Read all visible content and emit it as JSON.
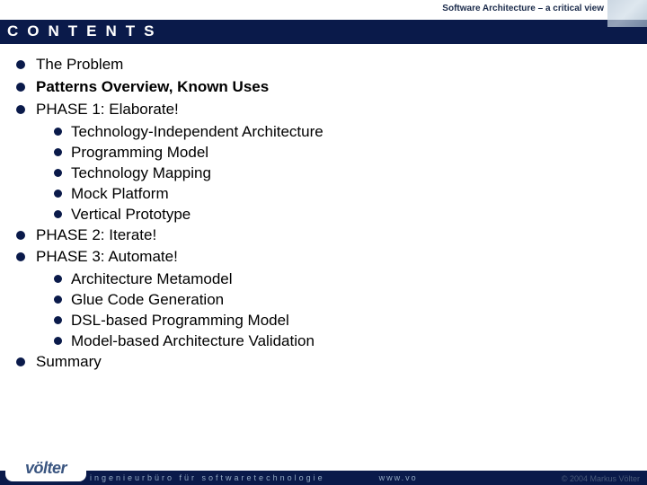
{
  "header_title": "Software Architecture – a critical view",
  "slide_title": "CONTENTS",
  "items": [
    {
      "text": "The Problem",
      "bold": false
    },
    {
      "text": "Patterns Overview, Known Uses",
      "bold": true
    },
    {
      "text": "PHASE 1: Elaborate!",
      "bold": false
    },
    {
      "sub": [
        "Technology-Independent Architecture",
        "Programming Model",
        "Technology Mapping",
        "Mock Platform",
        "Vertical Prototype"
      ]
    },
    {
      "text": "PHASE 2: Iterate!",
      "bold": false
    },
    {
      "text": "PHASE 3: Automate!",
      "bold": false
    },
    {
      "sub": [
        "Architecture Metamodel",
        "Glue Code Generation",
        "DSL-based Programming Model",
        "Model-based Architecture Validation"
      ]
    },
    {
      "text": "Summary",
      "bold": false
    }
  ],
  "footer_tagline": "ingenieurbüro für softwaretechnologie",
  "footer_url": "www.vo",
  "footer_copy": "© 2004  Markus Völter",
  "logo": "völter"
}
